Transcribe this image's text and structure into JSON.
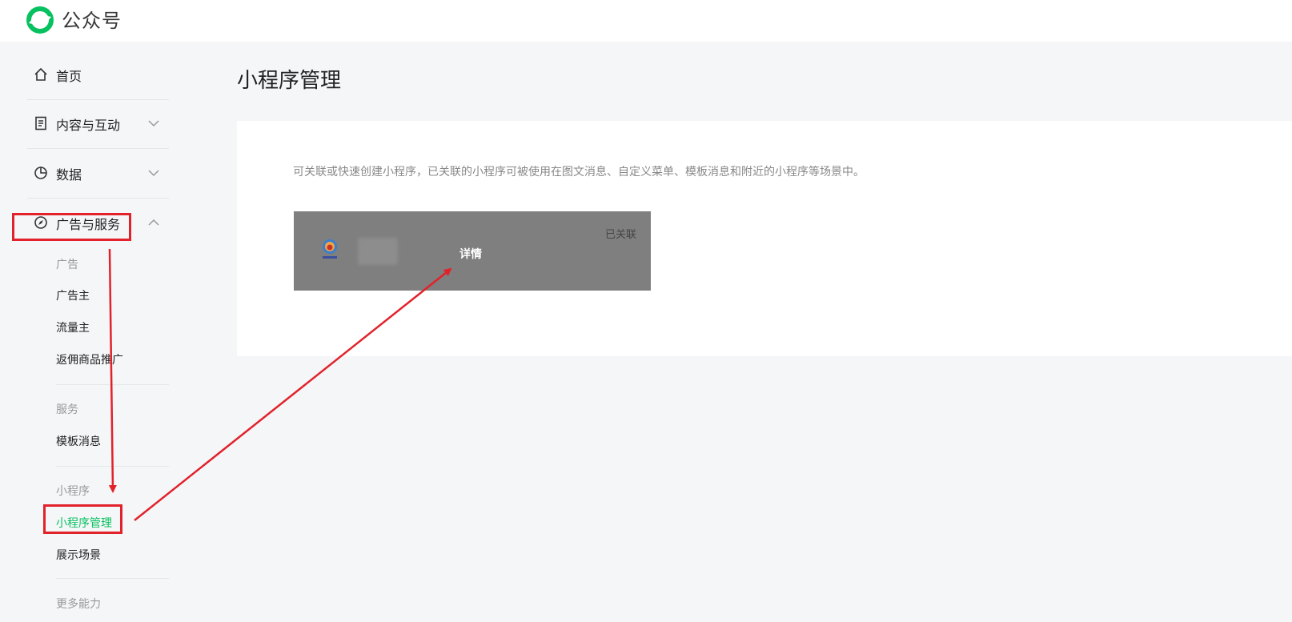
{
  "header": {
    "brand": "公众号"
  },
  "sidebar": {
    "home": "首页",
    "content": "内容与互动",
    "data": "数据",
    "ads_services": "广告与服务",
    "groups": {
      "ads": {
        "label": "广告",
        "items": [
          "广告主",
          "流量主",
          "返佣商品推广"
        ]
      },
      "services": {
        "label": "服务",
        "items": [
          "模板消息"
        ]
      },
      "miniprogram": {
        "label": "小程序",
        "items": [
          "小程序管理",
          "展示场景"
        ]
      },
      "more": {
        "label": "更多能力"
      }
    }
  },
  "main": {
    "title": "小程序管理",
    "description": "可关联或快速创建小程序，已关联的小程序可被使用在图文消息、自定义菜单、模板消息和附近的小程序等场景中。",
    "miniprogram_card": {
      "status": "已关联",
      "detail": "详情"
    }
  },
  "annotation": {
    "color": "#e1222b"
  },
  "colors": {
    "accent": "#07c160",
    "page_bg": "#f5f6f8"
  }
}
